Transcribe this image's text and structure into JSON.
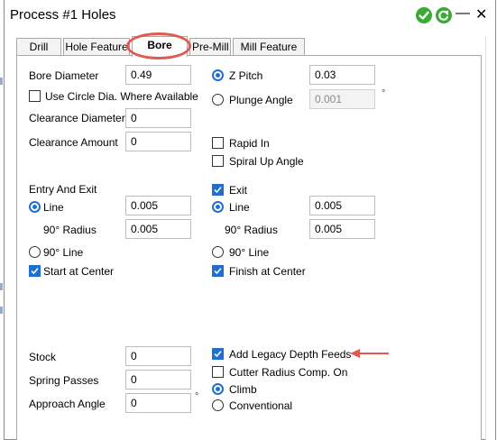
{
  "window": {
    "title": "Process #1 Holes"
  },
  "tabs": [
    {
      "label": "Drill"
    },
    {
      "label": "Hole Feature"
    },
    {
      "label": "Bore"
    },
    {
      "label": "Pre-Mill"
    },
    {
      "label": "Mill Feature"
    }
  ],
  "bore_diameter": {
    "label": "Bore Diameter",
    "value": "0.49"
  },
  "use_circle_dia": {
    "label": "Use Circle Dia. Where Available",
    "checked": false
  },
  "clearance_diameter": {
    "label": "Clearance Diameter",
    "value": "0"
  },
  "clearance_amount": {
    "label": "Clearance Amount",
    "value": "0"
  },
  "z_pitch": {
    "label": "Z Pitch",
    "value": "0.03",
    "selected": true
  },
  "plunge_angle": {
    "label": "Plunge Angle",
    "value": "0.001",
    "unit": "°",
    "selected": false
  },
  "rapid_in": {
    "label": "Rapid In",
    "checked": false
  },
  "spiral_up_angle": {
    "label": "Spiral Up Angle",
    "checked": false
  },
  "entry": {
    "label": "Entry And Exit",
    "line_label": "Line",
    "line_value": "0.005",
    "radius_label": "90° Radius",
    "radius_value": "0.005",
    "ninety_line_label": "90° Line",
    "start_center_label": "Start at Center"
  },
  "exit": {
    "label": "Exit",
    "line_label": "Line",
    "line_value": "0.005",
    "radius_label": "90° Radius",
    "radius_value": "0.005",
    "ninety_line_label": "90° Line",
    "finish_center_label": "Finish at Center"
  },
  "stock": {
    "label": "Stock",
    "value": "0"
  },
  "spring_passes": {
    "label": "Spring Passes",
    "value": "0"
  },
  "approach_angle": {
    "label": "Approach Angle",
    "value": "0",
    "unit": "°"
  },
  "legacy_depth": {
    "label": "Add Legacy Depth Feeds",
    "checked": true
  },
  "cutter_radius": {
    "label": "Cutter Radius Comp. On",
    "checked": false
  },
  "climb": {
    "label": "Climb",
    "selected": true
  },
  "conventional": {
    "label": "Conventional",
    "selected": false
  },
  "colors": {
    "accent": "#1f6fd0",
    "annotation": "#e05a4f",
    "ok_button": "#3aaa35"
  },
  "icons": {
    "ok": "check-circle-icon",
    "apply": "refresh-circle-icon",
    "minimize": "minimize-icon",
    "close": "close-icon",
    "arrow": "annotation-arrow-icon",
    "highlight": "annotation-ellipse-icon"
  }
}
